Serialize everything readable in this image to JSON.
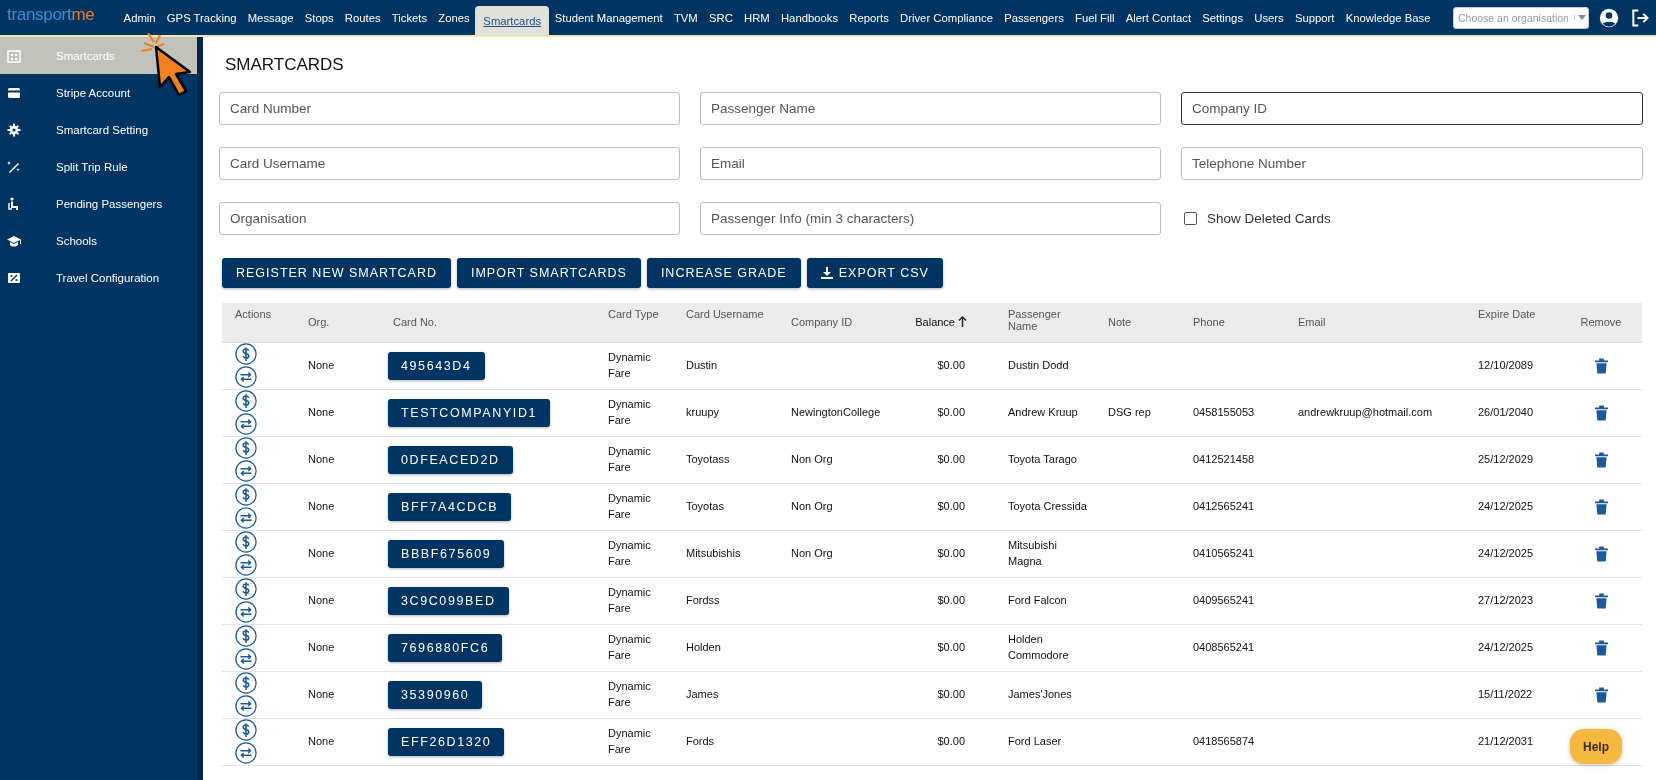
{
  "logo": {
    "main": "transport",
    "accent": "me"
  },
  "nav": [
    {
      "label": "Admin",
      "selected": false
    },
    {
      "label": "GPS Tracking",
      "selected": false
    },
    {
      "label": "Message",
      "selected": false
    },
    {
      "label": "Stops",
      "selected": false
    },
    {
      "label": "Routes",
      "selected": false
    },
    {
      "label": "Tickets",
      "selected": false
    },
    {
      "label": "Zones",
      "selected": false
    },
    {
      "label": "Smartcards",
      "selected": true
    },
    {
      "label": "Student Management",
      "selected": false
    },
    {
      "label": "TVM",
      "selected": false
    },
    {
      "label": "SRC",
      "selected": false
    },
    {
      "label": "HRM",
      "selected": false
    },
    {
      "label": "Handbooks",
      "selected": false
    },
    {
      "label": "Reports",
      "selected": false
    },
    {
      "label": "Driver Compliance",
      "selected": false
    },
    {
      "label": "Passengers",
      "selected": false
    },
    {
      "label": "Fuel Fill",
      "selected": false
    },
    {
      "label": "Alert Contact",
      "selected": false
    },
    {
      "label": "Settings",
      "selected": false
    },
    {
      "label": "Users",
      "selected": false
    },
    {
      "label": "Support",
      "selected": false
    },
    {
      "label": "Knowledge Base",
      "selected": false
    }
  ],
  "organisation_select": {
    "placeholder": "Choose an organisation"
  },
  "sidebar": {
    "items": [
      {
        "label": "Smartcards",
        "selected": true
      },
      {
        "label": "Stripe Account",
        "selected": false
      },
      {
        "label": "Smartcard Setting",
        "selected": false
      },
      {
        "label": "Split Trip Rule",
        "selected": false
      },
      {
        "label": "Pending Passengers",
        "selected": false
      },
      {
        "label": "Schools",
        "selected": false
      },
      {
        "label": "Travel Configuration",
        "selected": false
      }
    ]
  },
  "page_title": "SMARTCARDS",
  "filters": [
    {
      "kind": "field",
      "placeholder": "Card Number",
      "focused": false
    },
    {
      "kind": "field",
      "placeholder": "Passenger Name",
      "focused": false
    },
    {
      "kind": "field",
      "placeholder": "Company ID",
      "focused": true
    },
    {
      "kind": "field",
      "placeholder": "Card Username",
      "focused": false
    },
    {
      "kind": "field",
      "placeholder": "Email",
      "focused": false
    },
    {
      "kind": "field",
      "placeholder": "Telephone Number",
      "focused": false
    },
    {
      "kind": "field",
      "placeholder": "Organisation",
      "focused": false
    },
    {
      "kind": "field",
      "placeholder": "Passenger Info (min 3 characters)",
      "focused": false
    },
    {
      "kind": "checkbox",
      "label": "Show Deleted Cards",
      "checked": false
    }
  ],
  "buttons": [
    {
      "label": "REGISTER NEW SMARTCARD",
      "kind": "plain"
    },
    {
      "label": "IMPORT SMARTCARDS",
      "kind": "plain"
    },
    {
      "label": "INCREASE GRADE",
      "kind": "plain"
    },
    {
      "label": "EXPORT CSV",
      "kind": "download"
    }
  ],
  "table": {
    "columns": [
      {
        "label": "Actions",
        "sorted": false
      },
      {
        "label": "Org.",
        "sorted": false
      },
      {
        "label": "Card No.",
        "sorted": false
      },
      {
        "label": "Card Type",
        "sorted": false
      },
      {
        "label": "Card Username",
        "sorted": false
      },
      {
        "label": "Company ID",
        "sorted": false
      },
      {
        "label": "Balance",
        "sorted": true
      },
      {
        "label": "Passenger Name",
        "sorted": false
      },
      {
        "label": "Note",
        "sorted": false
      },
      {
        "label": "Phone",
        "sorted": false
      },
      {
        "label": "Email",
        "sorted": false
      },
      {
        "label": "Expire Date",
        "sorted": false
      },
      {
        "label": "Remove",
        "sorted": false
      }
    ],
    "rows": [
      {
        "org": "None",
        "card_no": "495643D4",
        "card_type": "Dynamic Fare",
        "card_username": "Dustin",
        "balance": "$0.00",
        "passenger_name": "Dustin Dodd",
        "expire_date": "12/10/2089",
        "trash_shown": true
      },
      {
        "org": "None",
        "card_no": "TESTCOMPANYID1",
        "card_type": "Dynamic Fare",
        "card_username": "kruupy",
        "company_id": "NewingtonCollege",
        "balance": "$0.00",
        "passenger_name": "Andrew Kruup",
        "note": "DSG rep",
        "phone": "0458155053",
        "email": "andrewkruup@hotmail.com",
        "expire_date": "26/01/2040",
        "trash_shown": true
      },
      {
        "org": "None",
        "card_no": "0DFEACED2D",
        "card_type": "Dynamic Fare",
        "card_username": "Toyotass",
        "company_id": "Non Org",
        "balance": "$0.00",
        "passenger_name": "Toyota Tarago",
        "phone": "0412521458",
        "expire_date": "25/12/2029",
        "trash_shown": true
      },
      {
        "org": "None",
        "card_no": "BFF7A4CDCB",
        "card_type": "Dynamic Fare",
        "card_username": "Toyotas",
        "company_id": "Non Org",
        "balance": "$0.00",
        "passenger_name": "Toyota Cressida",
        "phone": "0412565241",
        "expire_date": "24/12/2025",
        "trash_shown": true
      },
      {
        "org": "None",
        "card_no": "BBBF675609",
        "card_type": "Dynamic Fare",
        "card_username": "Mitsubishis",
        "company_id": "Non Org",
        "balance": "$0.00",
        "passenger_name": "Mitsubishi Magna",
        "phone": "0410565241",
        "expire_date": "24/12/2025",
        "trash_shown": true
      },
      {
        "org": "None",
        "card_no": "3C9C099BED",
        "card_type": "Dynamic Fare",
        "card_username": "Fordss",
        "balance": "$0.00",
        "passenger_name": "Ford Falcon",
        "phone": "0409565241",
        "expire_date": "27/12/2023",
        "trash_shown": true
      },
      {
        "org": "None",
        "card_no": "7696880FC6",
        "card_type": "Dynamic Fare",
        "card_username": "Holden",
        "balance": "$0.00",
        "passenger_name": "Holden Commodore",
        "phone": "0408565241",
        "expire_date": "24/12/2025",
        "trash_shown": true
      },
      {
        "org": "None",
        "card_no": "35390960",
        "card_type": "Dynamic Fare",
        "card_username": "James",
        "balance": "$0.00",
        "passenger_name": "James'Jones",
        "expire_date": "15/11/2022",
        "trash_shown": true
      },
      {
        "org": "None",
        "card_no": "EFF26D1320",
        "card_type": "Dynamic Fare",
        "card_username": "Fords",
        "balance": "$0.00",
        "passenger_name": "Ford Laser",
        "phone": "0418565874",
        "expire_date": "21/12/2031",
        "trash_shown": false
      }
    ]
  },
  "help_button": {
    "label": "Help"
  }
}
